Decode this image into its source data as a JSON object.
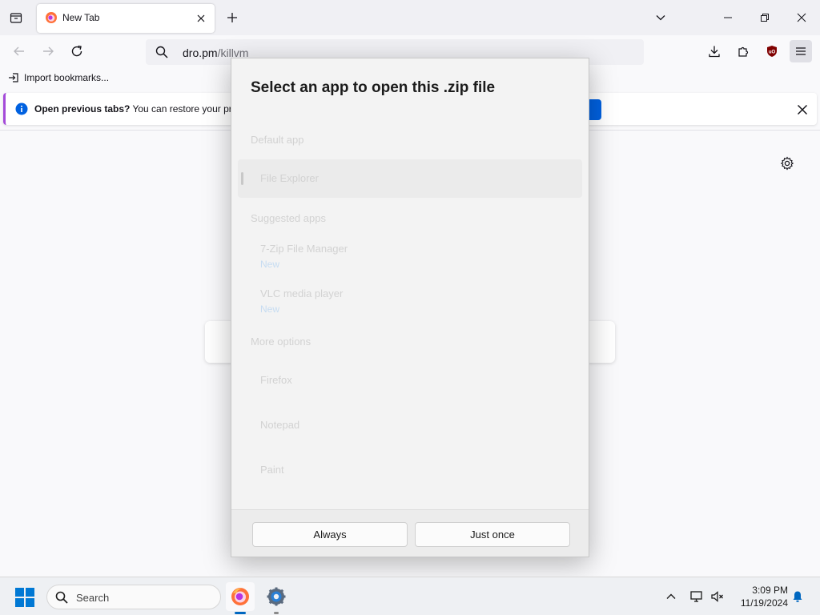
{
  "browser": {
    "tab": {
      "title": "New Tab"
    },
    "url": {
      "host": "dro.pm",
      "path": "/killvm"
    },
    "bookmarks": {
      "import_label": "Import bookmarks..."
    },
    "notice": {
      "bold_text": "Open previous tabs?",
      "text": " You can restore your previ"
    }
  },
  "dialog": {
    "title": "Select an app to open this .zip file",
    "sections": {
      "default": "Default app",
      "suggested": "Suggested apps",
      "more": "More options"
    },
    "default_app": {
      "name": "File Explorer"
    },
    "suggested_apps": [
      {
        "name": "7-Zip File Manager",
        "sub": "New"
      },
      {
        "name": "VLC media player",
        "sub": "New"
      }
    ],
    "more_apps": [
      {
        "name": "Firefox"
      },
      {
        "name": "Notepad"
      },
      {
        "name": "Paint"
      }
    ],
    "buttons": {
      "always": "Always",
      "just_once": "Just once"
    }
  },
  "taskbar": {
    "search_placeholder": "Search",
    "clock": {
      "time": "3:09 PM",
      "date": "11/19/2024"
    }
  },
  "icons": {
    "tab_list": "tab-list-icon",
    "close": "close-icon",
    "plus": "plus-icon",
    "chevron_down": "chevron-down-icon",
    "back": "back-arrow-icon",
    "forward": "forward-arrow-icon",
    "reload": "reload-icon",
    "search": "search-icon",
    "download": "download-icon",
    "extensions": "puzzle-icon",
    "ublock": "ublock-shield-icon",
    "menu": "hamburger-menu-icon",
    "info": "info-icon",
    "gear": "gear-icon",
    "windows": "windows-logo-icon",
    "firefox": "firefox-icon",
    "settings_app": "settings-app-icon",
    "chevron_up": "chevron-up-icon",
    "network": "network-icon",
    "volume": "volume-icon",
    "notification": "notification-bell-icon"
  },
  "colors": {
    "accent": "#0061e0",
    "notice_border": "#a44bd9",
    "taskbar_indicator": "#0067c0",
    "ublock_red": "#800000"
  }
}
